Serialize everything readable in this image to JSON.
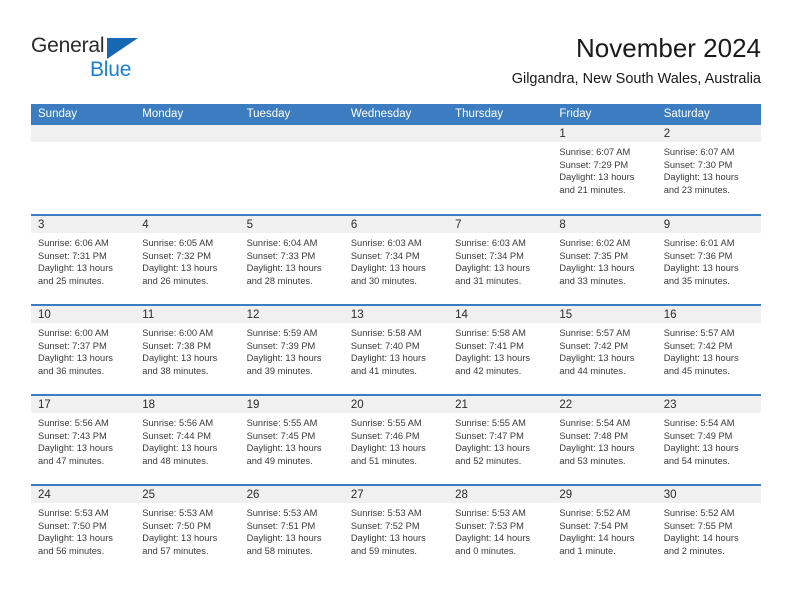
{
  "brand": {
    "name_part1": "General",
    "name_part2": "Blue",
    "triangle_icon": "triangle-logo-icon",
    "colors": {
      "blue": "#1b7fd4",
      "dark_blue": "#1668b3",
      "text": "#2b2b2b"
    }
  },
  "header": {
    "title": "November 2024",
    "subtitle": "Gilgandra, New South Wales, Australia"
  },
  "theme": {
    "header_bg": "#3b7dc0",
    "daynum_bg": "#f0f0f0",
    "cell_bg": "#ffffff",
    "text": "#3a3a3a"
  },
  "weekday_headers": [
    "Sunday",
    "Monday",
    "Tuesday",
    "Wednesday",
    "Thursday",
    "Friday",
    "Saturday"
  ],
  "weeks": [
    [
      {
        "day": "",
        "sunrise": "",
        "sunset": "",
        "daylight_line1": "",
        "daylight_line2": "",
        "empty": true
      },
      {
        "day": "",
        "sunrise": "",
        "sunset": "",
        "daylight_line1": "",
        "daylight_line2": "",
        "empty": true
      },
      {
        "day": "",
        "sunrise": "",
        "sunset": "",
        "daylight_line1": "",
        "daylight_line2": "",
        "empty": true
      },
      {
        "day": "",
        "sunrise": "",
        "sunset": "",
        "daylight_line1": "",
        "daylight_line2": "",
        "empty": true
      },
      {
        "day": "",
        "sunrise": "",
        "sunset": "",
        "daylight_line1": "",
        "daylight_line2": "",
        "empty": true
      },
      {
        "day": "1",
        "sunrise": "Sunrise: 6:07 AM",
        "sunset": "Sunset: 7:29 PM",
        "daylight_line1": "Daylight: 13 hours",
        "daylight_line2": "and 21 minutes.",
        "empty": false
      },
      {
        "day": "2",
        "sunrise": "Sunrise: 6:07 AM",
        "sunset": "Sunset: 7:30 PM",
        "daylight_line1": "Daylight: 13 hours",
        "daylight_line2": "and 23 minutes.",
        "empty": false
      }
    ],
    [
      {
        "day": "3",
        "sunrise": "Sunrise: 6:06 AM",
        "sunset": "Sunset: 7:31 PM",
        "daylight_line1": "Daylight: 13 hours",
        "daylight_line2": "and 25 minutes.",
        "empty": false
      },
      {
        "day": "4",
        "sunrise": "Sunrise: 6:05 AM",
        "sunset": "Sunset: 7:32 PM",
        "daylight_line1": "Daylight: 13 hours",
        "daylight_line2": "and 26 minutes.",
        "empty": false
      },
      {
        "day": "5",
        "sunrise": "Sunrise: 6:04 AM",
        "sunset": "Sunset: 7:33 PM",
        "daylight_line1": "Daylight: 13 hours",
        "daylight_line2": "and 28 minutes.",
        "empty": false
      },
      {
        "day": "6",
        "sunrise": "Sunrise: 6:03 AM",
        "sunset": "Sunset: 7:34 PM",
        "daylight_line1": "Daylight: 13 hours",
        "daylight_line2": "and 30 minutes.",
        "empty": false
      },
      {
        "day": "7",
        "sunrise": "Sunrise: 6:03 AM",
        "sunset": "Sunset: 7:34 PM",
        "daylight_line1": "Daylight: 13 hours",
        "daylight_line2": "and 31 minutes.",
        "empty": false
      },
      {
        "day": "8",
        "sunrise": "Sunrise: 6:02 AM",
        "sunset": "Sunset: 7:35 PM",
        "daylight_line1": "Daylight: 13 hours",
        "daylight_line2": "and 33 minutes.",
        "empty": false
      },
      {
        "day": "9",
        "sunrise": "Sunrise: 6:01 AM",
        "sunset": "Sunset: 7:36 PM",
        "daylight_line1": "Daylight: 13 hours",
        "daylight_line2": "and 35 minutes.",
        "empty": false
      }
    ],
    [
      {
        "day": "10",
        "sunrise": "Sunrise: 6:00 AM",
        "sunset": "Sunset: 7:37 PM",
        "daylight_line1": "Daylight: 13 hours",
        "daylight_line2": "and 36 minutes.",
        "empty": false
      },
      {
        "day": "11",
        "sunrise": "Sunrise: 6:00 AM",
        "sunset": "Sunset: 7:38 PM",
        "daylight_line1": "Daylight: 13 hours",
        "daylight_line2": "and 38 minutes.",
        "empty": false
      },
      {
        "day": "12",
        "sunrise": "Sunrise: 5:59 AM",
        "sunset": "Sunset: 7:39 PM",
        "daylight_line1": "Daylight: 13 hours",
        "daylight_line2": "and 39 minutes.",
        "empty": false
      },
      {
        "day": "13",
        "sunrise": "Sunrise: 5:58 AM",
        "sunset": "Sunset: 7:40 PM",
        "daylight_line1": "Daylight: 13 hours",
        "daylight_line2": "and 41 minutes.",
        "empty": false
      },
      {
        "day": "14",
        "sunrise": "Sunrise: 5:58 AM",
        "sunset": "Sunset: 7:41 PM",
        "daylight_line1": "Daylight: 13 hours",
        "daylight_line2": "and 42 minutes.",
        "empty": false
      },
      {
        "day": "15",
        "sunrise": "Sunrise: 5:57 AM",
        "sunset": "Sunset: 7:42 PM",
        "daylight_line1": "Daylight: 13 hours",
        "daylight_line2": "and 44 minutes.",
        "empty": false
      },
      {
        "day": "16",
        "sunrise": "Sunrise: 5:57 AM",
        "sunset": "Sunset: 7:42 PM",
        "daylight_line1": "Daylight: 13 hours",
        "daylight_line2": "and 45 minutes.",
        "empty": false
      }
    ],
    [
      {
        "day": "17",
        "sunrise": "Sunrise: 5:56 AM",
        "sunset": "Sunset: 7:43 PM",
        "daylight_line1": "Daylight: 13 hours",
        "daylight_line2": "and 47 minutes.",
        "empty": false
      },
      {
        "day": "18",
        "sunrise": "Sunrise: 5:56 AM",
        "sunset": "Sunset: 7:44 PM",
        "daylight_line1": "Daylight: 13 hours",
        "daylight_line2": "and 48 minutes.",
        "empty": false
      },
      {
        "day": "19",
        "sunrise": "Sunrise: 5:55 AM",
        "sunset": "Sunset: 7:45 PM",
        "daylight_line1": "Daylight: 13 hours",
        "daylight_line2": "and 49 minutes.",
        "empty": false
      },
      {
        "day": "20",
        "sunrise": "Sunrise: 5:55 AM",
        "sunset": "Sunset: 7:46 PM",
        "daylight_line1": "Daylight: 13 hours",
        "daylight_line2": "and 51 minutes.",
        "empty": false
      },
      {
        "day": "21",
        "sunrise": "Sunrise: 5:55 AM",
        "sunset": "Sunset: 7:47 PM",
        "daylight_line1": "Daylight: 13 hours",
        "daylight_line2": "and 52 minutes.",
        "empty": false
      },
      {
        "day": "22",
        "sunrise": "Sunrise: 5:54 AM",
        "sunset": "Sunset: 7:48 PM",
        "daylight_line1": "Daylight: 13 hours",
        "daylight_line2": "and 53 minutes.",
        "empty": false
      },
      {
        "day": "23",
        "sunrise": "Sunrise: 5:54 AM",
        "sunset": "Sunset: 7:49 PM",
        "daylight_line1": "Daylight: 13 hours",
        "daylight_line2": "and 54 minutes.",
        "empty": false
      }
    ],
    [
      {
        "day": "24",
        "sunrise": "Sunrise: 5:53 AM",
        "sunset": "Sunset: 7:50 PM",
        "daylight_line1": "Daylight: 13 hours",
        "daylight_line2": "and 56 minutes.",
        "empty": false
      },
      {
        "day": "25",
        "sunrise": "Sunrise: 5:53 AM",
        "sunset": "Sunset: 7:50 PM",
        "daylight_line1": "Daylight: 13 hours",
        "daylight_line2": "and 57 minutes.",
        "empty": false
      },
      {
        "day": "26",
        "sunrise": "Sunrise: 5:53 AM",
        "sunset": "Sunset: 7:51 PM",
        "daylight_line1": "Daylight: 13 hours",
        "daylight_line2": "and 58 minutes.",
        "empty": false
      },
      {
        "day": "27",
        "sunrise": "Sunrise: 5:53 AM",
        "sunset": "Sunset: 7:52 PM",
        "daylight_line1": "Daylight: 13 hours",
        "daylight_line2": "and 59 minutes.",
        "empty": false
      },
      {
        "day": "28",
        "sunrise": "Sunrise: 5:53 AM",
        "sunset": "Sunset: 7:53 PM",
        "daylight_line1": "Daylight: 14 hours",
        "daylight_line2": "and 0 minutes.",
        "empty": false
      },
      {
        "day": "29",
        "sunrise": "Sunrise: 5:52 AM",
        "sunset": "Sunset: 7:54 PM",
        "daylight_line1": "Daylight: 14 hours",
        "daylight_line2": "and 1 minute.",
        "empty": false
      },
      {
        "day": "30",
        "sunrise": "Sunrise: 5:52 AM",
        "sunset": "Sunset: 7:55 PM",
        "daylight_line1": "Daylight: 14 hours",
        "daylight_line2": "and 2 minutes.",
        "empty": false
      }
    ]
  ]
}
